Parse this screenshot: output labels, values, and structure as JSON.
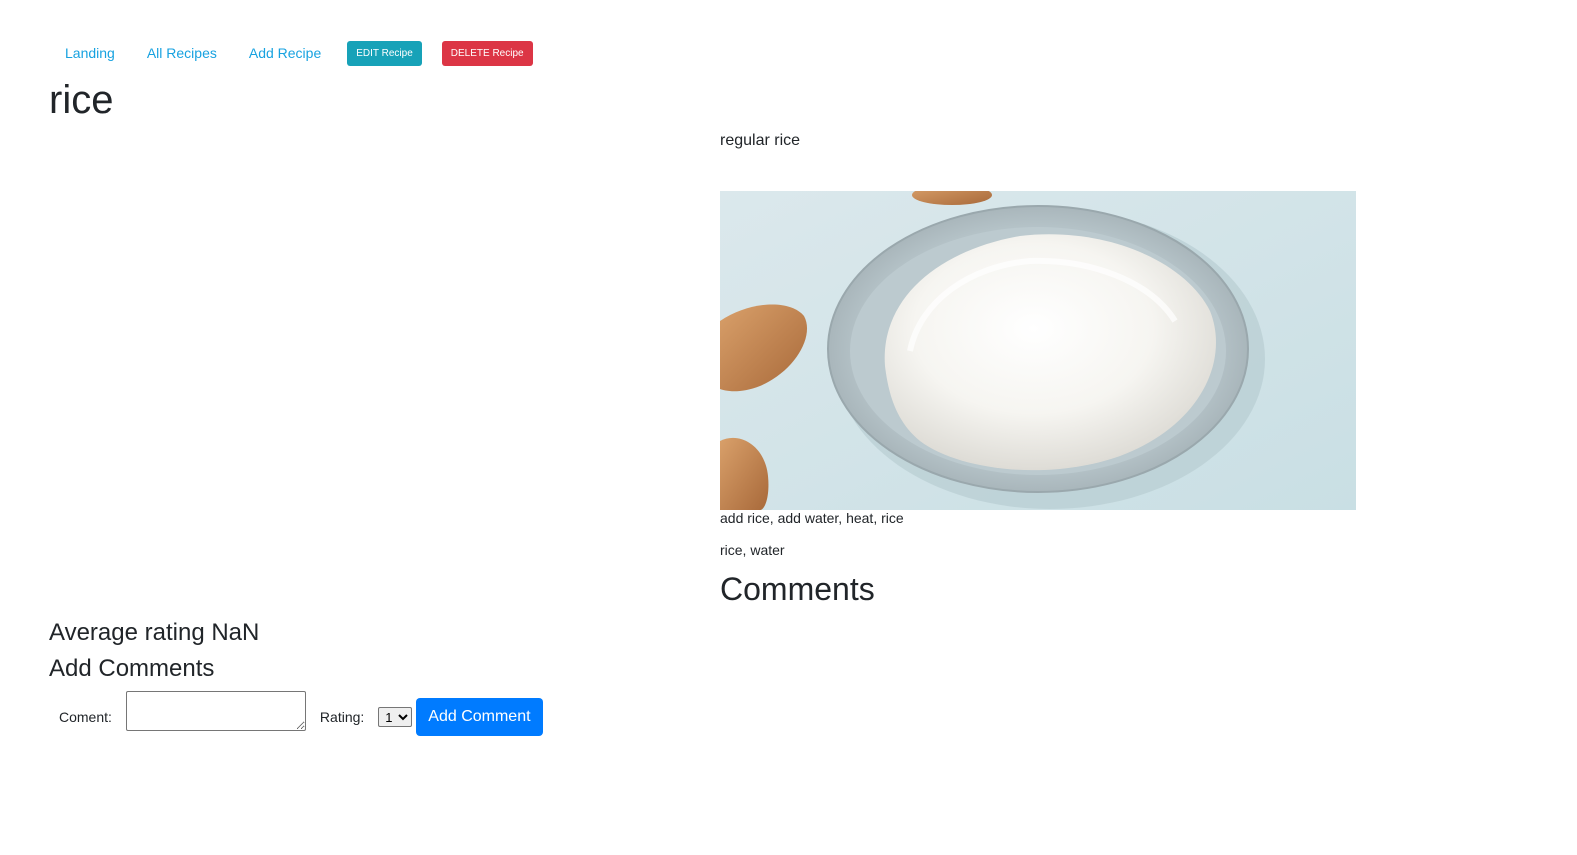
{
  "nav": {
    "landing": "Landing",
    "all_recipes": "All Recipes",
    "add_recipe": "Add Recipe",
    "edit_recipe": "EDIT Recipe",
    "delete_recipe": "DELETE Recipe"
  },
  "recipe": {
    "title": "rice",
    "description": "regular rice",
    "image_subject": "bowl of cooked white rice with wooden spoons",
    "instructions": "add rice, add water, heat, rice",
    "ingredients": "rice, water"
  },
  "comments": {
    "heading": "Comments"
  },
  "rating": {
    "average_text": "Average rating NaN"
  },
  "add_comment_form": {
    "heading": "Add Comments",
    "comment_label": "Coment:",
    "comment_value": "",
    "rating_label": "Rating:",
    "rating_selected": "1",
    "submit_label": "Add Comment"
  },
  "colors": {
    "link": "#17a2e0",
    "edit_button": "#17a2b8",
    "delete_button": "#dc3545",
    "primary_button": "#007bff",
    "image_background": "#d6e6ea"
  }
}
